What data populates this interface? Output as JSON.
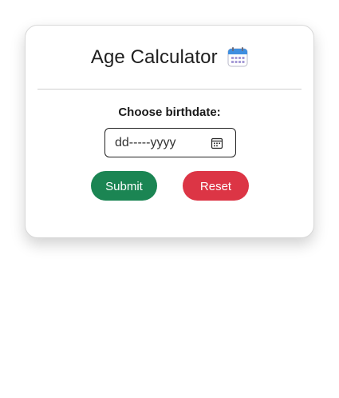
{
  "app": {
    "title": "Age Calculator",
    "title_icon": "calendar-icon"
  },
  "form": {
    "label": "Choose birthdate:",
    "date_input": {
      "value": "dd-----yyyy",
      "icon": "calendar-picker-icon"
    }
  },
  "buttons": {
    "submit_label": "Submit",
    "reset_label": "Reset"
  },
  "colors": {
    "submit": "#1b8553",
    "reset": "#dc3545"
  }
}
